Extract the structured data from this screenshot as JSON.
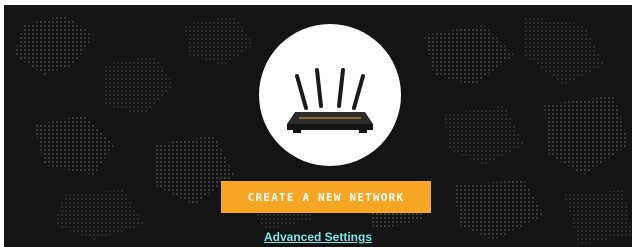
{
  "hero": {
    "router_image": "router-icon",
    "create_button_label": "CREATE A NEW NETWORK",
    "advanced_link_label": "Advanced Settings"
  },
  "colors": {
    "background": "#141414",
    "accent": "#f5a623",
    "link": "#7fe3e8"
  }
}
